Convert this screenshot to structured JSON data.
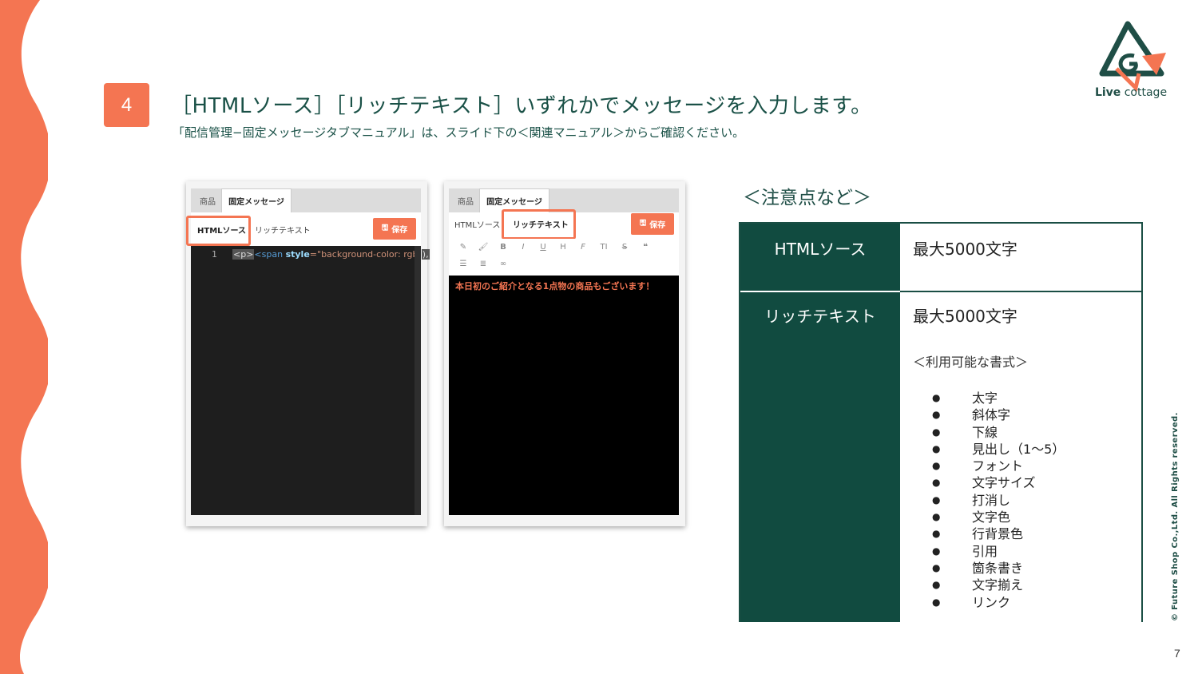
{
  "step": {
    "number": "4"
  },
  "headline": "［HTMLソース］［リッチテキスト］いずれかでメッセージを入力します。",
  "subline": "「配信管理−固定メッセージタブマニュアル」は、スライド下の＜関連マニュアル＞からご確認ください。",
  "logo": {
    "bold": "Live",
    "rest": " cottage"
  },
  "left_screenshot": {
    "tabs": [
      "商品",
      "固定メッセージ"
    ],
    "mode_html": "HTMLソース",
    "mode_rich": "リッチテキスト",
    "save": "保存",
    "line_number": "1",
    "code_p": "<p>",
    "code_span": "<span",
    "code_attr": "style",
    "code_str": "=\"background-color: rgb(",
    "code_tail": "),"
  },
  "right_screenshot": {
    "tabs": [
      "商品",
      "固定メッセージ"
    ],
    "mode_html": "HTMLソース",
    "mode_rich": "リッチテキスト",
    "save": "保存",
    "toolbar_icons": [
      "eraser-icon",
      "brush-icon",
      "bold-icon",
      "italic-icon",
      "underline-icon",
      "heading-icon",
      "font-icon",
      "text-size-icon",
      "strikethrough-icon",
      "quote-icon",
      "list-icon",
      "align-icon",
      "link-icon"
    ],
    "message": "本日初のご紹介となる1点物の商品もございます！"
  },
  "notes": {
    "title": "＜注意点など＞",
    "rows": [
      {
        "label": "HTMLソース",
        "value": "最大5000文字"
      },
      {
        "label": "リッチテキスト",
        "value": "最大5000文字",
        "sub_head": "＜利用可能な書式＞",
        "formats": [
          "太字",
          "斜体字",
          "下線",
          "見出し（1〜5）",
          "フォント",
          "文字サイズ",
          "打消し",
          "文字色",
          "行背景色",
          "引用",
          "箇条書き",
          "文字揃え",
          "リンク"
        ]
      }
    ]
  },
  "copyright": "© Future Shop Co.,Ltd. All Rights reserved.",
  "page_number": "7",
  "colors": {
    "accent": "#f47552",
    "dark_green": "#114b40",
    "text_green": "#1a5147"
  }
}
